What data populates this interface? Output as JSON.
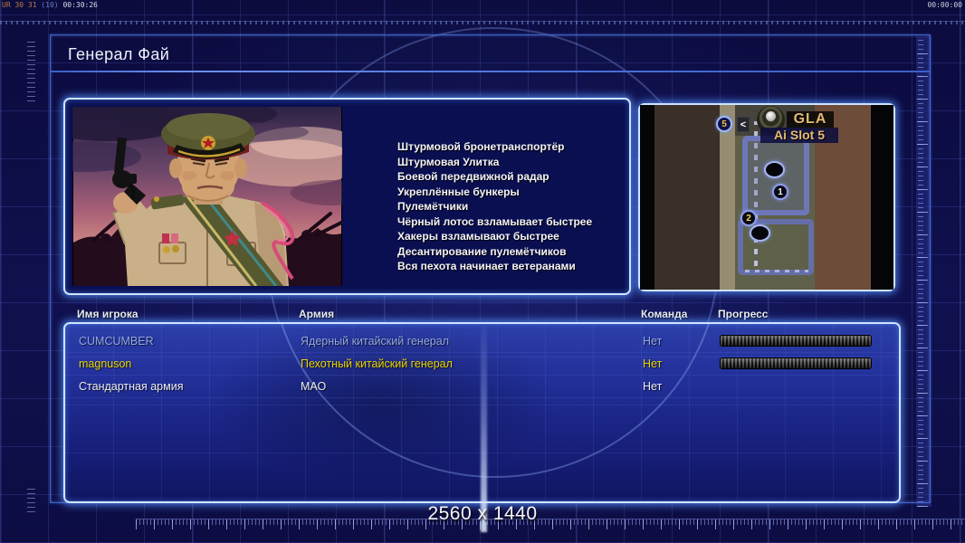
{
  "hud": {
    "top_left_status": {
      "part1": "UR 30 31",
      "part2": "(10)",
      "part3": "00:30:26"
    },
    "top_right_timer": "00:00:00",
    "resolution_label": "2560 x 1440"
  },
  "header": {
    "title": "Генерал Фай"
  },
  "general_info": {
    "abilities": [
      "Штурмовой бронетранспортёр",
      "Штурмовая Улитка",
      "Боевой передвижной радар",
      "Укреплённые бункеры",
      "Пулемётчики",
      "Чёрный лотос взламывает быстрее",
      "Хакеры взламывают быстрее",
      "Десантирование пулемётчиков",
      "Вся пехота начинает ветеранами"
    ]
  },
  "map_preview": {
    "faction_label": "GLA",
    "slot_label": "Ai Slot 5",
    "player_badge": "5",
    "back_arrow": "<",
    "marker_1": "1",
    "marker_2": "2"
  },
  "players_table": {
    "columns": [
      "Имя игрока",
      "Армия",
      "Команда",
      "Прогресс"
    ],
    "rows": [
      {
        "name": "CUMCUMBER",
        "army": "Ядерный китайский генерал",
        "team": "Нет",
        "color": "#93a7e2",
        "progress_full": true
      },
      {
        "name": "magnuson",
        "army": "Пехотный китайский генерал",
        "team": "Нет",
        "color": "#e9d400",
        "progress_full": true
      },
      {
        "name": "Стандартная армия",
        "army": "МАО",
        "team": "Нет",
        "color": "#eceef4",
        "progress_full": false
      }
    ]
  },
  "colors": {
    "panel_glow": "#cfe4ff",
    "gold_accent": "#e5bb74"
  }
}
